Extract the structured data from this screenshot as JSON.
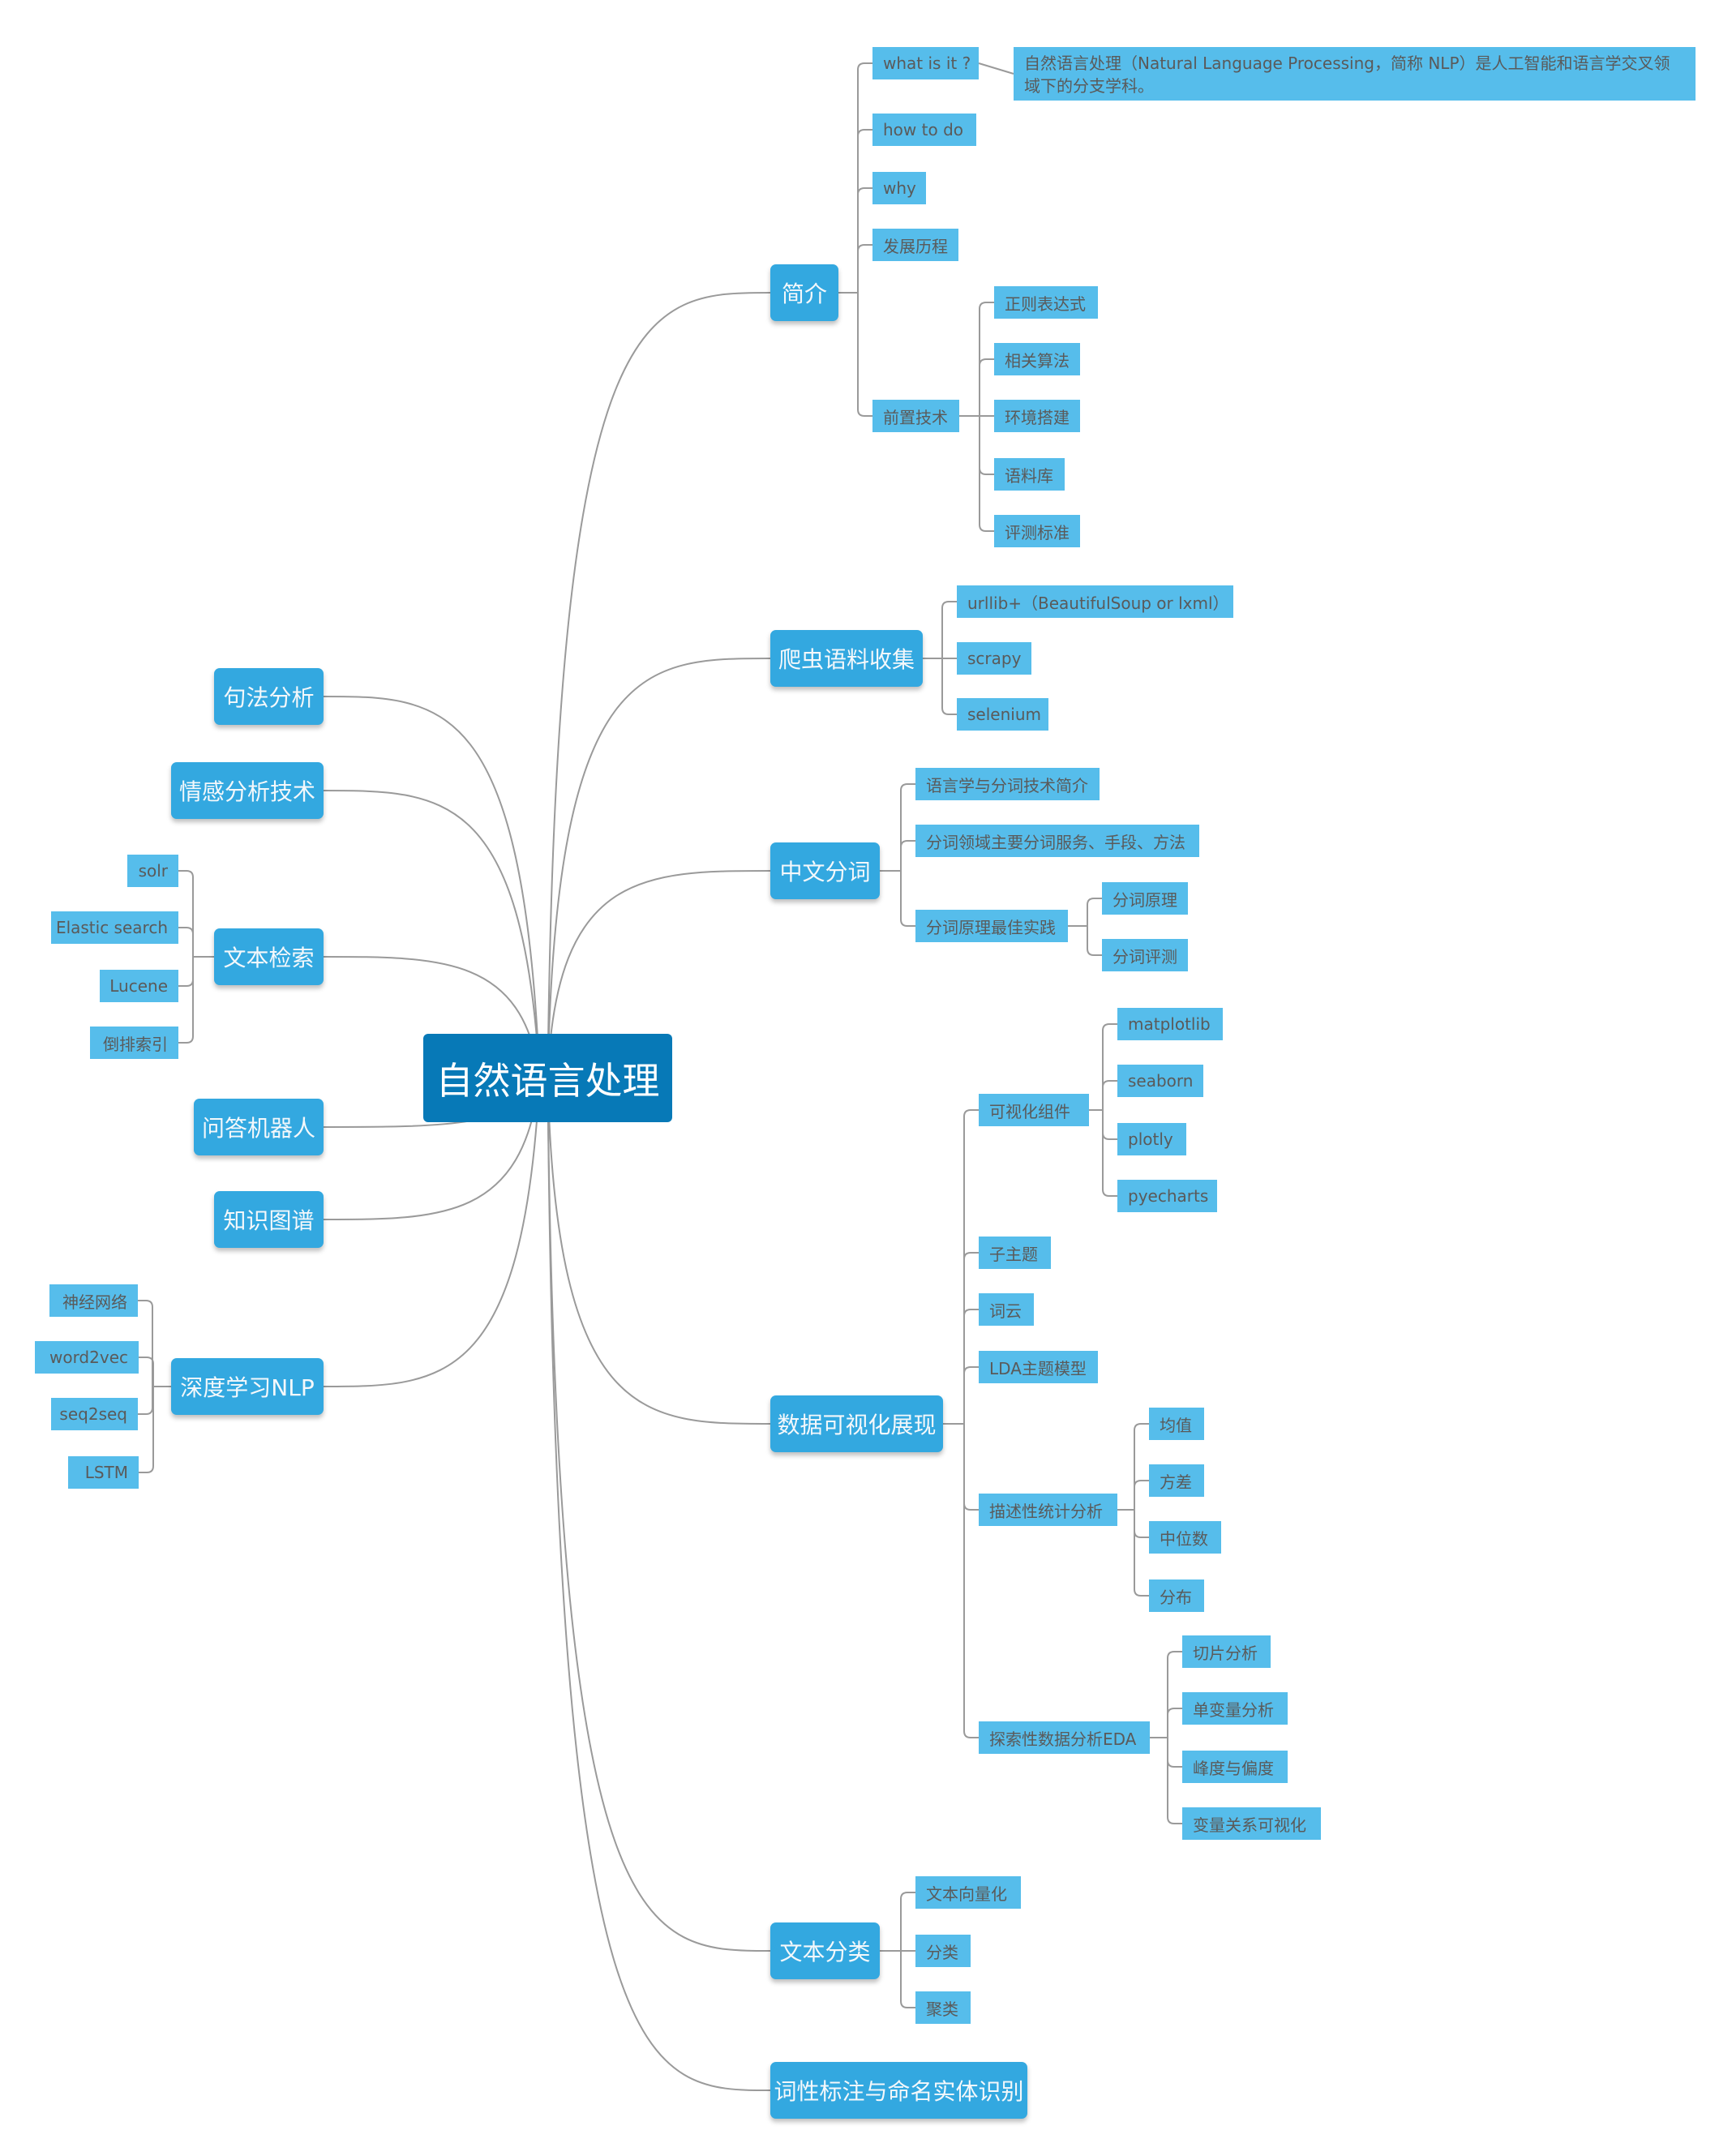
{
  "root": {
    "label": "自然语言处理"
  },
  "branches": {
    "intro": {
      "label": "简介",
      "children": {
        "what": {
          "label": "what is it ?"
        },
        "what_desc": {
          "label": "自然语言处理（Natural Language Processing，简称 NLP）是人工智能和语言学交叉领域下的分支学科。"
        },
        "how": {
          "label": "how to do"
        },
        "why": {
          "label": "why"
        },
        "history": {
          "label": "发展历程"
        },
        "prereq": {
          "label": "前置技术"
        },
        "regex": {
          "label": "正则表达式"
        },
        "algo": {
          "label": "相关算法"
        },
        "env": {
          "label": "环境搭建"
        },
        "corpus": {
          "label": "语料库"
        },
        "eval": {
          "label": "评测标准"
        }
      }
    },
    "crawler": {
      "label": "爬虫语料收集",
      "children": {
        "urllib": {
          "label": "urllib+（BeautifulSoup or lxml）"
        },
        "scrapy": {
          "label": "scrapy"
        },
        "selenium": {
          "label": "selenium"
        }
      }
    },
    "seg": {
      "label": "中文分词",
      "children": {
        "intro": {
          "label": "语言学与分词技术简介"
        },
        "services": {
          "label": "分词领域主要分词服务、手段、方法"
        },
        "practice": {
          "label": "分词原理最佳实践"
        },
        "principle": {
          "label": "分词原理"
        },
        "evaluation": {
          "label": "分词评测"
        }
      }
    },
    "viz": {
      "label": "数据可视化展现",
      "children": {
        "components": {
          "label": "可视化组件"
        },
        "matplotlib": {
          "label": "matplotlib"
        },
        "seaborn": {
          "label": "seaborn"
        },
        "plotly": {
          "label": "plotly"
        },
        "pyecharts": {
          "label": "pyecharts"
        },
        "subtopic": {
          "label": "子主题"
        },
        "wordcloud": {
          "label": "词云"
        },
        "lda": {
          "label": "LDA主题模型"
        },
        "desc_stats": {
          "label": "描述性统计分析"
        },
        "mean": {
          "label": "均值"
        },
        "variance": {
          "label": "方差"
        },
        "median": {
          "label": "中位数"
        },
        "distribution": {
          "label": "分布"
        },
        "eda": {
          "label": "探索性数据分析EDA"
        },
        "slice": {
          "label": "切片分析"
        },
        "univariate": {
          "label": "单变量分析"
        },
        "kurtosis": {
          "label": "峰度与偏度"
        },
        "relation": {
          "label": "变量关系可视化"
        }
      }
    },
    "textcls": {
      "label": "文本分类",
      "children": {
        "vectorize": {
          "label": "文本向量化"
        },
        "classify": {
          "label": "分类"
        },
        "cluster": {
          "label": "聚类"
        }
      }
    },
    "ner": {
      "label": "词性标注与命名实体识别"
    },
    "syntax": {
      "label": "句法分析"
    },
    "sentiment": {
      "label": "情感分析技术"
    },
    "retrieval": {
      "label": "文本检索",
      "children": {
        "solr": {
          "label": "solr"
        },
        "elastic": {
          "label": "Elastic search"
        },
        "lucene": {
          "label": "Lucene"
        },
        "inverted": {
          "label": "倒排索引"
        }
      }
    },
    "qa": {
      "label": "问答机器人"
    },
    "kg": {
      "label": "知识图谱"
    },
    "dl": {
      "label": "深度学习NLP",
      "children": {
        "nn": {
          "label": "神经网络"
        },
        "w2v": {
          "label": "word2vec"
        },
        "s2s": {
          "label": "seq2seq"
        },
        "lstm": {
          "label": "LSTM"
        }
      }
    }
  },
  "colors": {
    "root": "#0779b7",
    "main": "#33a8e0",
    "sub": "#56bdeb",
    "sub_text": "#5a5a5a",
    "line": "#9a9a9a"
  }
}
